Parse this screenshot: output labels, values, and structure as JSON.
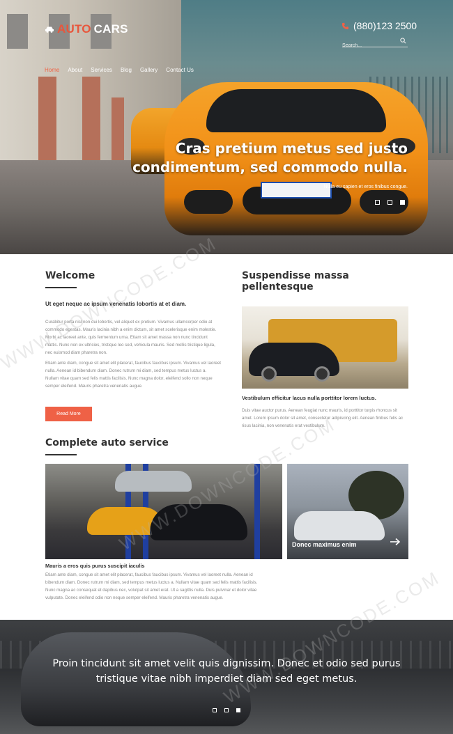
{
  "header": {
    "logo_word1": "AUTO",
    "logo_word2": "CARS",
    "phone": "(880)123 2500",
    "search_placeholder": "Search...",
    "nav": [
      "Home",
      "About",
      "Services",
      "Blog",
      "Gallery",
      "Contact Us"
    ],
    "active_nav": "Home"
  },
  "hero": {
    "title": "Cras pretium metus sed justo condimentum, sed commodo nulla.",
    "subtitle": "Nulla eu sapien et eros finibus congue.",
    "slides": 3,
    "active_slide": 3
  },
  "welcome": {
    "heading": "Welcome",
    "lead": "Ut eget neque ac ipsum venenatis lobortis at et diam.",
    "body1": "Curabitur porta nisl non dui lobortis, vel aliquet ex pretium. Vivamus ullamcorper odio at commodo egestas. Mauris lacinia nibh a enim dictum, sit amet scelerisque enim molestie. Morbi ac laoreet ante, quis fermentum urna. Etiam sit amet massa non nunc tincidunt mattis. Nunc non ex ultricies, tristique leo sed, vehicula mauris. Sed mollis tristique ligula, nec euismod diam pharetra non.",
    "body2": "Etiam ante diam, congue sit amet elit placerat, faucibus faucibus ipsum. Vivamus vel laoreet nulla. Aenean id bibendum diam. Donec rutrum mi diam, sed tempus metus luctus a. Nullam vitae quam sed felis mattis facilisis. Nunc magna dolor, eleifend sollo non neque semper eleifend. Mauris pharetra venenatis augue.",
    "button": "Read More"
  },
  "suspendisse": {
    "heading": "Suspendisse massa pellentesque",
    "caption": "Vestibulum efficitur lacus nulla porttitor lorem luctus.",
    "body": "Duis vitae auctor purus. Aenean feugiat nunc mauris, id porttitor turpis rhoncus sit amet. Lorem ipsum dolor sit amet, consectetur adipiscing elit. Aenean finibus felis ac risus lacinia, non venenatis erat vestibulum."
  },
  "service": {
    "heading": "Complete auto service",
    "gallery_label": "Donec maximus enim",
    "caption": "Mauris a eros quis purus suscipit iaculis",
    "body": "Etiam ante diam, congue sit amet elit placerat, faucibus faucibus ipsum. Vivamus vel laoreet nulla. Aenean id bibendum diam. Donec rutrum mi diam, sed tempus metus luctus a. Nullam vitae quam sed felis mattis facilisis. Nunc magna ac consequat et dapibus nec, volutpat sit amet erat. Ut a sagittis nulla. Duis pulvinar et dolor vitae vulputate. Donec eleifend odio non neque semper eleifend. Mauris pharetra venenatis augue."
  },
  "bottom": {
    "quote": "Proin tincidunt sit amet velit quis dignissim. Donec et odio sed purus tristique vitae nibh imperdiet diam sed eget metus.",
    "slides": 3,
    "active_slide": 3
  },
  "watermark": "WWW.DOWNCODE.COM",
  "colors": {
    "accent": "#ef6146",
    "text_dark": "#333333",
    "text_muted": "#888888"
  }
}
